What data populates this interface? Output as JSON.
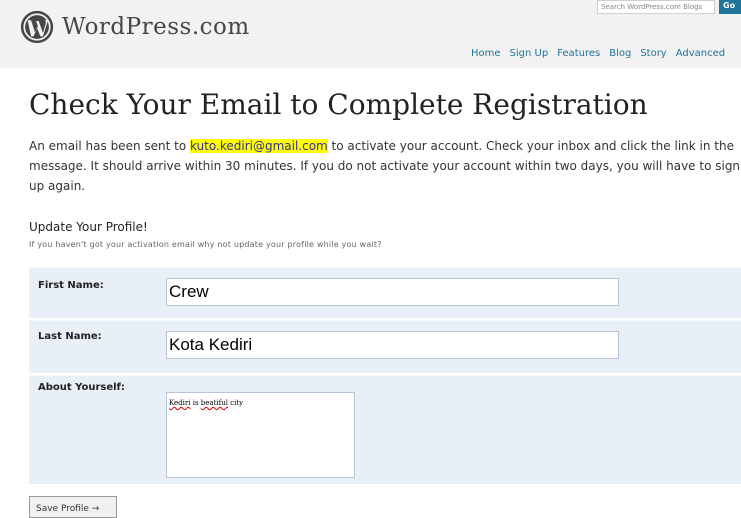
{
  "header": {
    "logo_text": "WordPress.com",
    "search_placeholder": "Search WordPress.com Blogs",
    "search_button": "Go",
    "nav": [
      "Home",
      "Sign Up",
      "Features",
      "Blog",
      "Story",
      "Advanced"
    ]
  },
  "main": {
    "title": "Check Your Email to Complete Registration",
    "intro_before": "An email has been sent to ",
    "email": "kuto.kediri@gmail.com",
    "intro_after": " to activate your account. Check your inbox and click the link in the message. It should arrive within 30 minutes. If you do not activate your account within two days, you will have to sign up again.",
    "profile_heading": "Update Your Profile!",
    "profile_sub": "If you haven't got your activation email why not update your profile while you wait?"
  },
  "form": {
    "first_name_label": "First Name:",
    "first_name_value": "Crew",
    "last_name_label": "Last Name:",
    "last_name_value": "Kota Kediri",
    "about_label": "About Yourself:",
    "about_word1": "Kediri",
    "about_mid": " is ",
    "about_word2": "beatiful",
    "about_end": " city",
    "save_label": "Save Profile →"
  }
}
